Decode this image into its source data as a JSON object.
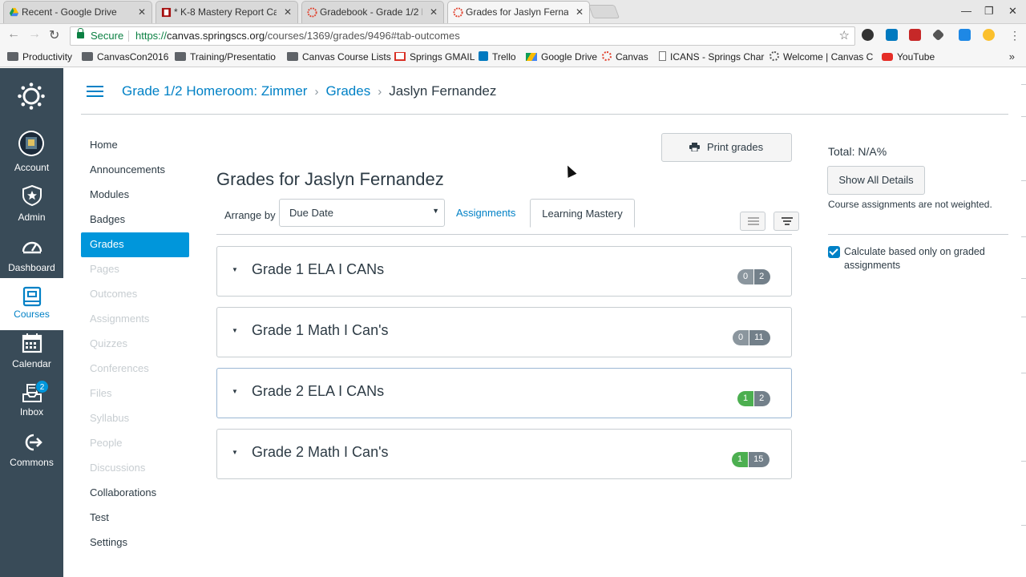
{
  "browser": {
    "tabs": [
      {
        "label": "Recent - Google Drive",
        "active": false
      },
      {
        "label": "* K-8 Mastery Report Ca",
        "active": false
      },
      {
        "label": "Gradebook - Grade 1/2 H",
        "active": false
      },
      {
        "label": "Grades for Jaslyn Ferna",
        "active": true
      }
    ],
    "secure_label": "Secure",
    "url_proto": "https://",
    "url_host": "canvas.springscs.org",
    "url_path": "/courses/1369/grades/9496#tab-outcomes",
    "bookmarks": [
      {
        "label": "Productivity",
        "icon": "folder-icon"
      },
      {
        "label": "CanvasCon2016",
        "icon": "folder-icon"
      },
      {
        "label": "Training/Presentatio",
        "icon": "folder-icon"
      },
      {
        "label": "Canvas Course Lists",
        "icon": "folder-icon"
      },
      {
        "label": "Springs GMAIL",
        "icon": "gmail-icon"
      },
      {
        "label": "Trello",
        "icon": "trello-icon"
      },
      {
        "label": "Google Drive",
        "icon": "drive-icon"
      },
      {
        "label": "Canvas",
        "icon": "canvas-icon"
      },
      {
        "label": "ICANS - Springs Char",
        "icon": "page-icon"
      },
      {
        "label": "Welcome | Canvas C",
        "icon": "canvas-icon"
      },
      {
        "label": "YouTube",
        "icon": "youtube-icon"
      }
    ],
    "bookmarks_more": "»"
  },
  "global_nav": {
    "items": [
      {
        "label": "Account",
        "icon": "avatar-icon"
      },
      {
        "label": "Admin",
        "icon": "shield-icon"
      },
      {
        "label": "Dashboard",
        "icon": "dashboard-icon"
      },
      {
        "label": "Courses",
        "icon": "courses-icon",
        "active": true
      },
      {
        "label": "Calendar",
        "icon": "calendar-icon"
      },
      {
        "label": "Inbox",
        "icon": "inbox-icon",
        "badge": "2"
      },
      {
        "label": "Commons",
        "icon": "commons-icon"
      }
    ]
  },
  "breadcrumb": {
    "course": "Grade 1/2 Homeroom: Zimmer",
    "section": "Grades",
    "current": "Jaslyn Fernandez",
    "separator": "›"
  },
  "course_nav": [
    {
      "label": "Home",
      "state": "normal"
    },
    {
      "label": "Announcements",
      "state": "normal"
    },
    {
      "label": "Modules",
      "state": "normal"
    },
    {
      "label": "Badges",
      "state": "normal"
    },
    {
      "label": "Grades",
      "state": "active"
    },
    {
      "label": "Pages",
      "state": "hidden"
    },
    {
      "label": "Outcomes",
      "state": "hidden"
    },
    {
      "label": "Assignments",
      "state": "hidden"
    },
    {
      "label": "Quizzes",
      "state": "hidden"
    },
    {
      "label": "Conferences",
      "state": "hidden"
    },
    {
      "label": "Files",
      "state": "hidden"
    },
    {
      "label": "Syllabus",
      "state": "hidden"
    },
    {
      "label": "People",
      "state": "hidden"
    },
    {
      "label": "Discussions",
      "state": "hidden"
    },
    {
      "label": "Collaborations",
      "state": "normal"
    },
    {
      "label": "Test",
      "state": "normal"
    },
    {
      "label": "Settings",
      "state": "normal"
    }
  ],
  "main": {
    "print_label": "Print grades",
    "title": "Grades for Jaslyn Fernandez",
    "arrange_label": "Arrange by",
    "arrange_value": "Due Date",
    "tabs": [
      "Assignments",
      "Learning Mastery"
    ],
    "outcome_groups": [
      {
        "title": "Grade 1 ELA I CANs",
        "mastered": "0",
        "total": "2"
      },
      {
        "title": "Grade 1 Math I Can's",
        "mastered": "0",
        "total": "11"
      },
      {
        "title": "Grade 2 ELA I CANs",
        "mastered": "1",
        "total": "2"
      },
      {
        "title": "Grade 2 Math I Can's",
        "mastered": "1",
        "total": "15"
      }
    ]
  },
  "sidebar": {
    "total": "Total: N/A%",
    "show_all_label": "Show All Details",
    "weighted_note": "Course assignments are not weighted.",
    "calc_label": "Calculate based only on graded assignments"
  },
  "colors": {
    "nav_bg": "#394b58",
    "link": "#0081c6",
    "active_nav": "#0096db",
    "mastery_green": "#4caf50"
  }
}
